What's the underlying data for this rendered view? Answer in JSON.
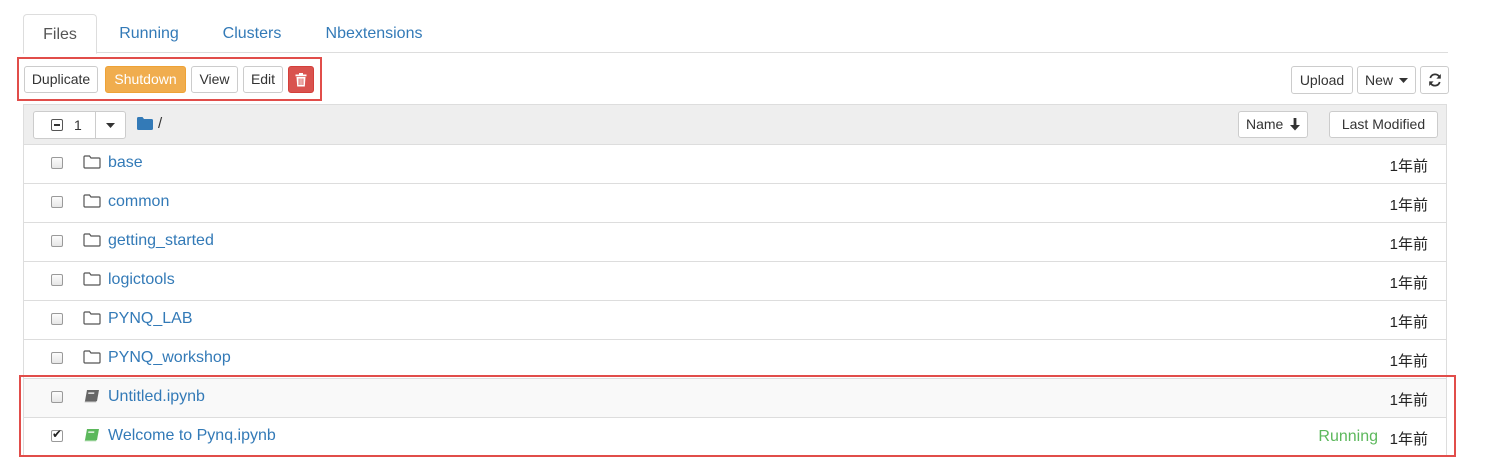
{
  "tabs": [
    {
      "label": "Files",
      "active": true
    },
    {
      "label": "Running"
    },
    {
      "label": "Clusters"
    },
    {
      "label": "Nbextensions"
    }
  ],
  "toolbar": {
    "duplicate": "Duplicate",
    "shutdown": "Shutdown",
    "view": "View",
    "edit": "Edit",
    "delete_icon": "trash-icon",
    "upload": "Upload",
    "new": "New",
    "refresh_icon": "refresh-icon"
  },
  "list_header": {
    "selected_count": "1",
    "path": "/",
    "sort_name": "Name",
    "sort_modified": "Last Modified"
  },
  "files": [
    {
      "name": "base",
      "type": "folder",
      "modified": "1年前",
      "checked": false
    },
    {
      "name": "common",
      "type": "folder",
      "modified": "1年前",
      "checked": false
    },
    {
      "name": "getting_started",
      "type": "folder",
      "modified": "1年前",
      "checked": false
    },
    {
      "name": "logictools",
      "type": "folder",
      "modified": "1年前",
      "checked": false
    },
    {
      "name": "PYNQ_LAB",
      "type": "folder",
      "modified": "1年前",
      "checked": false
    },
    {
      "name": "PYNQ_workshop",
      "type": "folder",
      "modified": "1年前",
      "checked": false
    },
    {
      "name": "Untitled.ipynb",
      "type": "notebook",
      "modified": "1年前",
      "checked": false
    },
    {
      "name": "Welcome to Pynq.ipynb",
      "type": "notebook-running",
      "modified": "1年前",
      "checked": true,
      "status": "Running"
    }
  ],
  "colors": {
    "link": "#337ab7",
    "warning": "#f0ad4e",
    "danger": "#d9534f",
    "running": "#5cb85c",
    "highlight": "#e14d4a"
  }
}
